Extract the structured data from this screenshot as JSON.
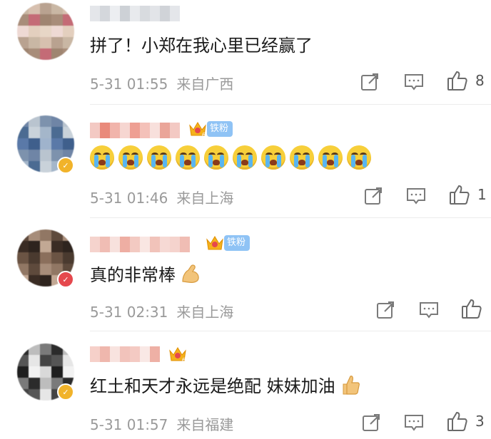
{
  "comments": [
    {
      "text": "拼了！小郑在我心里已经赢了",
      "time": "5-31 01:55",
      "location": "来自广西",
      "likes": "8",
      "avatar_colors": [
        "#c9b7a4",
        "#e7d6c6",
        "#a88d7a",
        "#d7c0af",
        "#eed9d4",
        "#c46b76",
        "#b9a290",
        "#e3cfbe",
        "#9f8571"
      ],
      "name_colors": [
        "#e4e6ea",
        "#d4d7dc",
        "#eceef1",
        "#cdd1d6",
        "#e8eaed",
        "#d8dbdf",
        "#e2e4e8",
        "#d0d3d8"
      ]
    },
    {
      "emoji_count": 10,
      "emoji_name": "crying-face-emoji",
      "time": "5-31 01:46",
      "location": "来自上海",
      "likes": "1",
      "fan_label": "铁粉",
      "crown_level": "6",
      "avatar_colors": [
        "#6f85a6",
        "#9fb3cc",
        "#4b6b92",
        "#b9c4cf",
        "#5a79a8",
        "#c9d2da",
        "#7d92ad",
        "#3f5f8c",
        "#a4b6ca"
      ],
      "name_colors": [
        "#f3c9c3",
        "#e98a7b",
        "#f1b4ab",
        "#f6d6d1",
        "#ee9f93",
        "#f4c1b9",
        "#f8e0dc",
        "#eaa599"
      ]
    },
    {
      "text": "真的非常棒",
      "emoji_name": "flexed-biceps-emoji",
      "time": "5-31 02:31",
      "location": "来自上海",
      "likes": "",
      "fan_label": "铁粉",
      "avatar_colors": [
        "#5e4a3c",
        "#8b6f5c",
        "#3a2c24",
        "#a78d7a",
        "#6b5444",
        "#2e241e",
        "#917764",
        "#4a3a2f",
        "#c2a894"
      ],
      "name_colors": [
        "#f5d3cd",
        "#f0bdb4",
        "#f7e1dd",
        "#eeaea3",
        "#f3cac2",
        "#f9e6e2",
        "#f1c3ba",
        "#f6d9d4"
      ]
    },
    {
      "text": "红土和天才永远是绝配 妹妹加油",
      "emoji_name": "thumbs-up-emoji",
      "time": "5-31 01:57",
      "location": "来自福建",
      "likes": "3",
      "crown_level": "6",
      "avatar_colors": [
        "#2b2b2b",
        "#d9d9d9",
        "#555555",
        "#bdbdbd",
        "#1e1e1e",
        "#e6e6e6",
        "#7a7a7a",
        "#f2f2f2",
        "#444444"
      ],
      "name_colors": [
        "#f6d0c9",
        "#efb7ad",
        "#f8e3df",
        "#f2c3bb",
        "#f4cac3",
        "#f9e8e5",
        "#eeb0a5",
        "#f5d6d0"
      ]
    }
  ],
  "icons": {
    "repost": "share-icon",
    "comment": "comment-icon",
    "like": "thumbs-up-icon"
  },
  "colors": {
    "meta_text": "#9a9a9a",
    "fan_badge": "#8fc3f5",
    "crown": "#f5b21c"
  }
}
